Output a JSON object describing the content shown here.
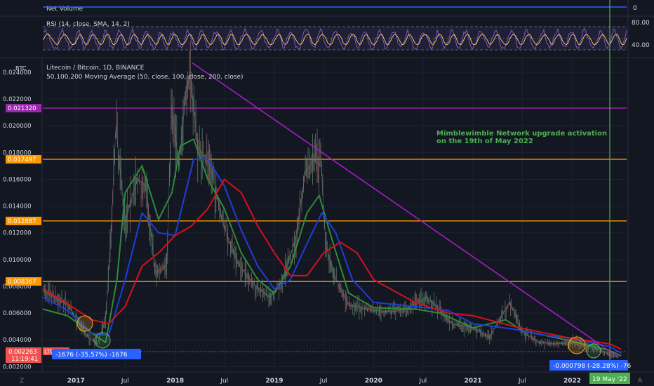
{
  "chart_data": [
    {
      "type": "line",
      "title": "Net Volume",
      "ylabel_right": "0"
    },
    {
      "type": "line",
      "title": "RSI (14, close, SMA, 14, 2)",
      "y_ticks": [
        "80.00",
        "40.00"
      ],
      "ylim": [
        25,
        90
      ]
    },
    {
      "type": "line",
      "title": "Litecoin / Bitcoin, 1D, BINANCE",
      "subtitle": "50,100,200 Moving Average (50, close, 100, close, 200, close)",
      "currency": "BTC",
      "ylim": [
        0.0016,
        0.0251
      ],
      "x_ticks": [
        "2017",
        "Jul",
        "2018",
        "Jul",
        "2019",
        "Jul",
        "2020",
        "Jul",
        "2021",
        "Jul",
        "2022"
      ],
      "y_ticks": [
        "0.024000",
        "0.022000",
        "0.020000",
        "0.018000",
        "0.016000",
        "0.014000",
        "0.012000",
        "0.010000",
        "0.008000",
        "0.006000",
        "0.004000",
        "0.002000"
      ],
      "x_range": [
        "2016-09-01",
        "2022-07-20"
      ],
      "series": [
        {
          "name": "",
          "color": "#8f93a0",
          "x": [
            "2016-09-01",
            "2016-12-01",
            "2017-02-15",
            "2017-03-20",
            "2017-04-20",
            "2017-05-10",
            "2017-05-28",
            "2017-07-01",
            "2017-08-15",
            "2017-09-15",
            "2017-10-20",
            "2017-12-01",
            "2017-12-19",
            "2018-01-15",
            "2018-02-10",
            "2018-02-25",
            "2018-03-25",
            "2018-05-10",
            "2018-06-25",
            "2018-08-15",
            "2018-10-15",
            "2018-12-15",
            "2019-01-25",
            "2019-03-20",
            "2019-04-25",
            "2019-05-25",
            "2019-06-22",
            "2019-07-10",
            "2019-08-15",
            "2019-10-01",
            "2020-01-01",
            "2020-03-12",
            "2020-05-01",
            "2020-07-15",
            "2020-08-20",
            "2020-10-15",
            "2021-01-01",
            "2021-03-01",
            "2021-05-15",
            "2021-06-01",
            "2021-07-01",
            "2021-09-01",
            "2021-11-01",
            "2022-01-10",
            "2022-03-15",
            "2022-05-19",
            "2022-06-20"
          ],
          "values": [
            0.0077,
            0.0066,
            0.0042,
            0.0037,
            0.0055,
            0.012,
            0.02,
            0.013,
            0.016,
            0.0155,
            0.009,
            0.0096,
            0.0215,
            0.017,
            0.0225,
            0.024,
            0.0185,
            0.017,
            0.0128,
            0.0098,
            0.0082,
            0.0072,
            0.0081,
            0.0115,
            0.0165,
            0.0175,
            0.017,
            0.011,
            0.0085,
            0.0066,
            0.0062,
            0.0061,
            0.0063,
            0.0072,
            0.0064,
            0.0052,
            0.0049,
            0.0042,
            0.0068,
            0.0061,
            0.0046,
            0.0038,
            0.0037,
            0.0038,
            0.0035,
            0.0029,
            0.0027
          ]
        },
        {
          "name": "",
          "color": "#2e8b3a",
          "x": [
            "2016-09-01",
            "2016-12-01",
            "2017-03-01",
            "2017-04-20",
            "2017-06-01",
            "2017-07-01",
            "2017-09-01",
            "2017-11-01",
            "2017-12-20",
            "2018-01-20",
            "2018-03-10",
            "2018-05-01",
            "2018-07-01",
            "2018-09-01",
            "2018-11-01",
            "2019-01-01",
            "2019-03-01",
            "2019-05-01",
            "2019-06-15",
            "2019-08-01",
            "2019-10-01",
            "2020-01-01",
            "2020-06-01",
            "2020-09-01",
            "2021-01-01",
            "2021-05-01",
            "2021-07-01",
            "2022-01-01",
            "2022-05-19",
            "2022-06-30"
          ],
          "values": [
            0.0063,
            0.0058,
            0.0045,
            0.0038,
            0.0085,
            0.015,
            0.017,
            0.013,
            0.015,
            0.0185,
            0.019,
            0.016,
            0.0138,
            0.0105,
            0.0085,
            0.0075,
            0.0095,
            0.0135,
            0.0148,
            0.0115,
            0.0075,
            0.0064,
            0.0063,
            0.006,
            0.0049,
            0.0055,
            0.0047,
            0.0039,
            0.0032,
            0.0028
          ]
        },
        {
          "name": "",
          "color": "#1c3fd6",
          "x": [
            "2016-09-01",
            "2016-12-01",
            "2017-03-01",
            "2017-05-01",
            "2017-07-01",
            "2017-09-01",
            "2017-11-01",
            "2018-01-01",
            "2018-03-10",
            "2018-05-01",
            "2018-07-01",
            "2018-09-01",
            "2018-11-01",
            "2019-01-01",
            "2019-03-01",
            "2019-05-01",
            "2019-06-25",
            "2019-08-15",
            "2019-10-15",
            "2020-01-01",
            "2020-06-01",
            "2020-10-01",
            "2021-01-01",
            "2021-06-01",
            "2021-09-01",
            "2022-01-01",
            "2022-05-19",
            "2022-06-30"
          ],
          "values": [
            0.0072,
            0.0062,
            0.0045,
            0.0043,
            0.0085,
            0.0135,
            0.012,
            0.0118,
            0.0175,
            0.0175,
            0.0155,
            0.0122,
            0.0095,
            0.0078,
            0.0085,
            0.0112,
            0.0135,
            0.012,
            0.0085,
            0.0068,
            0.0065,
            0.0062,
            0.0052,
            0.0048,
            0.0044,
            0.0041,
            0.0035,
            0.003
          ]
        },
        {
          "name": "",
          "color": "#d6101c",
          "x": [
            "2016-09-01",
            "2016-12-01",
            "2017-03-01",
            "2017-05-01",
            "2017-07-01",
            "2017-09-01",
            "2017-11-01",
            "2018-01-01",
            "2018-03-01",
            "2018-05-01",
            "2018-07-01",
            "2018-09-01",
            "2018-11-01",
            "2019-01-01",
            "2019-03-01",
            "2019-05-01",
            "2019-07-01",
            "2019-09-01",
            "2019-11-01",
            "2020-01-01",
            "2020-06-01",
            "2020-10-01",
            "2021-01-01",
            "2021-06-01",
            "2021-09-01",
            "2022-01-01",
            "2022-05-19",
            "2022-06-30"
          ],
          "values": [
            0.0078,
            0.0067,
            0.0055,
            0.0052,
            0.0065,
            0.0095,
            0.0105,
            0.0118,
            0.0125,
            0.0138,
            0.016,
            0.015,
            0.0125,
            0.0105,
            0.0088,
            0.0088,
            0.0105,
            0.0113,
            0.0105,
            0.0085,
            0.0068,
            0.006,
            0.0058,
            0.005,
            0.0046,
            0.0041,
            0.0037,
            0.0033
          ]
        }
      ],
      "hlines": [
        {
          "value": 0.02132,
          "label": "0.021320",
          "color": "#9c27b0"
        },
        {
          "value": 0.017497,
          "label": "0.017497",
          "color": "#ff9800"
        },
        {
          "value": 0.012887,
          "label": "0.012887",
          "color": "#ff9800"
        },
        {
          "value": 0.008367,
          "label": "0.008367",
          "color": "#ff9800"
        }
      ],
      "trendline": {
        "color": "#a020c0",
        "x": [
          "2018-03-05",
          "2022-06-20"
        ],
        "values": [
          0.0247,
          0.0027
        ]
      },
      "vline": {
        "x": "2022-05-19",
        "color": "#4caf50",
        "label": "19 May '22"
      },
      "annotation": {
        "text_line1": "Mimblewimble Network upgrade activation",
        "text_line2": "on the 19th of May 2022",
        "color": "#4caf50"
      },
      "price_label": {
        "value": "0.002263",
        "countdown": "11:19:41",
        "symbol": "LTCBTC"
      },
      "measure_labels": {
        "left": "-1676 (-35.57%) -1676",
        "right": "-0.000798 (-28.28%) -76"
      },
      "corner_left": "Z",
      "corner_right": "A"
    }
  ]
}
